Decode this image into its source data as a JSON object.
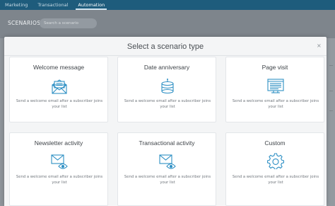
{
  "nav": {
    "tabs": [
      {
        "label": "Marketing"
      },
      {
        "label": "Transactional"
      },
      {
        "label": "Automation"
      }
    ],
    "active_tab": "Automation"
  },
  "scenarios_bar": {
    "title": "SCENARIOS",
    "search_placeholder": "Search a scenario"
  },
  "modal": {
    "title": "Select a scenario type",
    "close_glyph": "×",
    "cards": [
      {
        "title": "Welcome message",
        "icon": "envelope-icon",
        "description": "Send a welcome email after a subscriber joins your list"
      },
      {
        "title": "Date anniversary",
        "icon": "cake-icon",
        "description": "Send a welcome email after a subscriber joins your list"
      },
      {
        "title": "Page visit",
        "icon": "web-page-icon",
        "description": "Send a welcome email after a subscriber joins your list"
      },
      {
        "title": "Newsletter activity",
        "icon": "envelope-eye-icon",
        "description": "Send a welcome email after a subscriber joins your list"
      },
      {
        "title": "Transactional activity",
        "icon": "envelope-eye-icon",
        "description": "Send a welcome email after a subscriber joins your list"
      },
      {
        "title": "Custom",
        "icon": "gear-icon",
        "description": "Send a welcome email after a subscriber joins your list"
      }
    ]
  },
  "colors": {
    "nav_bg": "#1e5c7c",
    "icon_blue": "#2d8fc4",
    "overlay_gray": "#8f959b"
  }
}
